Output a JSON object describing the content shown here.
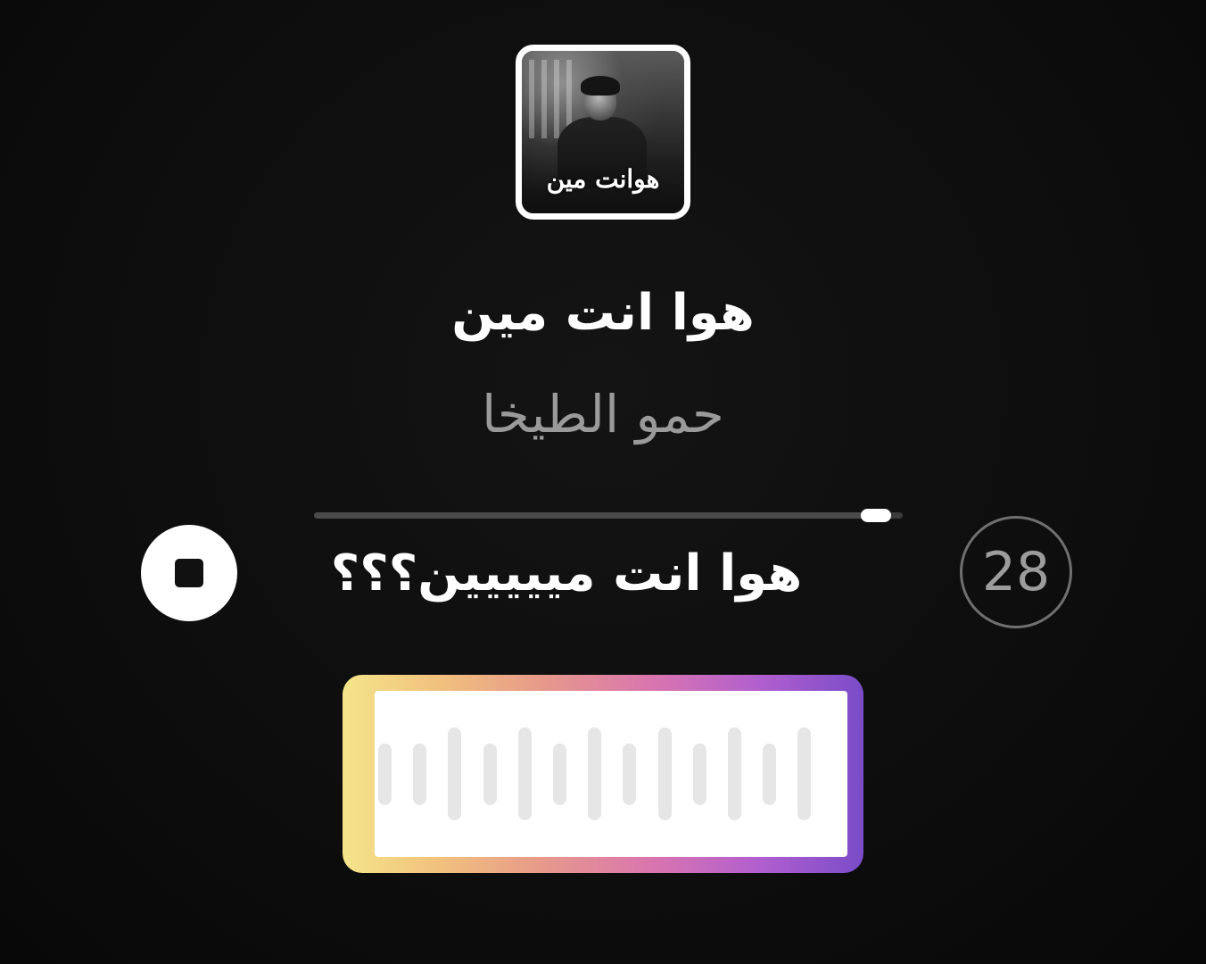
{
  "album": {
    "cover_text": "هوانت مين"
  },
  "song": {
    "title": "هوا انت مين",
    "artist": "حمو الطيخا"
  },
  "player": {
    "progress": 0.98,
    "lyric": "هوا انت مييييين؟؟؟",
    "countdown": "28",
    "stop_icon": "stop-icon"
  },
  "voice_sticker": {
    "icon": "waveform-icon",
    "colors": [
      "#f4e58a",
      "#e79a8a",
      "#d874b0",
      "#7a4cc8"
    ],
    "levels": [
      0.4,
      0.4,
      0.6,
      0.4,
      0.6,
      0.4,
      0.6,
      0.4,
      0.6,
      0.4,
      0.6,
      0.4,
      0.6
    ]
  }
}
